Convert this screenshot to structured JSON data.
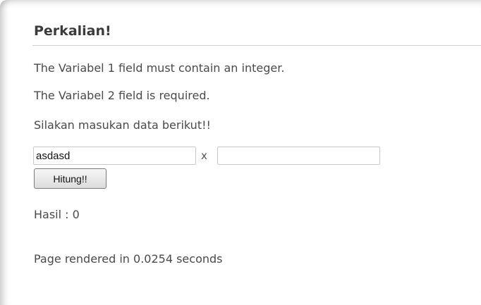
{
  "page": {
    "title": "Perkalian!",
    "errors": [
      "The Variabel 1 field must contain an integer.",
      "The Variabel 2 field is required."
    ],
    "prompt": "Silakan masukan data berikut!!"
  },
  "form": {
    "variabel1_value": "asdasd",
    "variabel2_value": "",
    "operator": "x",
    "submit_label": "Hitung!!"
  },
  "result": {
    "text": "Hasil : 0"
  },
  "footer": {
    "render_time": "Page rendered in 0.0254 seconds"
  },
  "colors": {
    "text": "#4a4a4a",
    "heading": "#3b3b3b",
    "rule": "#d0d0d0"
  }
}
